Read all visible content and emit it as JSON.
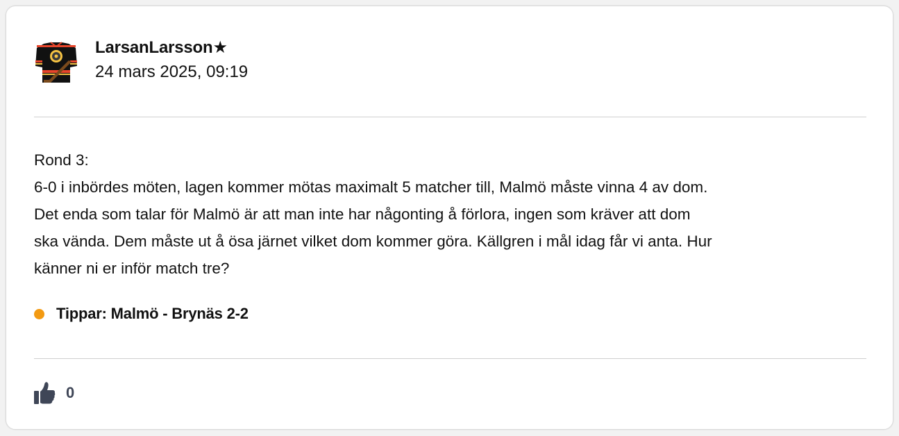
{
  "post": {
    "author": "LarsanLarsson★",
    "date": "24 mars 2025, 09:19",
    "body": [
      "Rond 3:",
      "6-0 i inbördes möten, lagen kommer mötas maximalt 5 matcher till, Malmö måste vinna 4 av dom.",
      "Det enda som talar för Malmö är att man inte har någonting å förlora, ingen som kräver att dom",
      "ska vända. Dem måste ut å ösa järnet vilket dom kommer göra. Källgren i mål idag får vi anta. Hur",
      "känner ni er inför match tre?"
    ],
    "prediction": "Tippar: Malmö - Brynäs 2-2",
    "likes": "0"
  },
  "icons": {
    "avatar": "hockey-jersey-avatar",
    "prediction_dot": "status-dot",
    "like": "thumbs-up-icon"
  },
  "colors": {
    "prediction_dot": "#f39a12",
    "like_icon": "#3f4657",
    "jersey_primary": "#111111",
    "jersey_stripe": "#e8452b",
    "jersey_accent": "#f6c343"
  }
}
